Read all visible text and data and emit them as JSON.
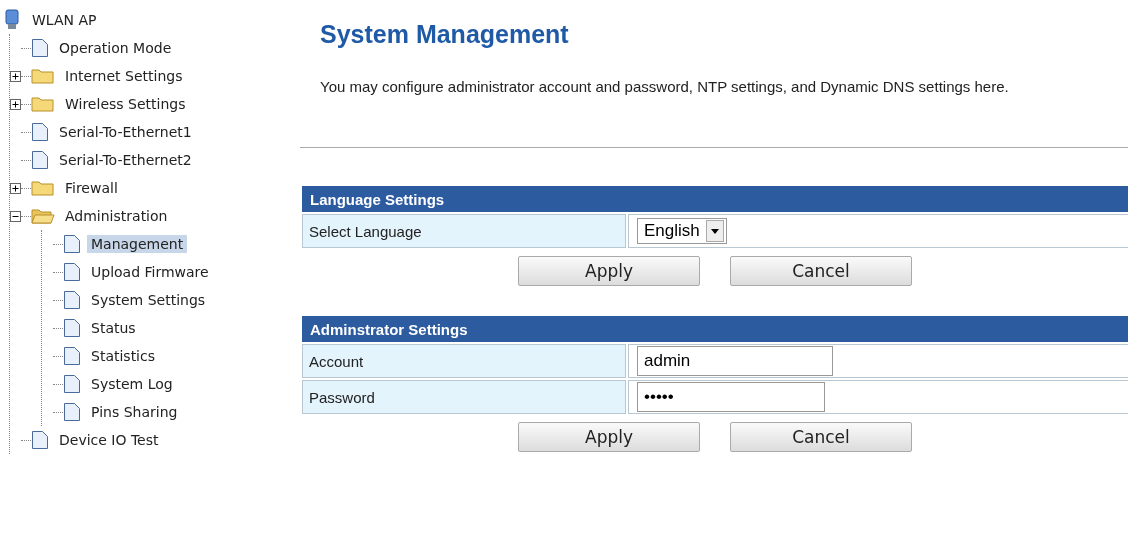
{
  "sidebar": {
    "tree": [
      {
        "label": "WLAN AP",
        "kind": "root",
        "selected": false,
        "children": [
          {
            "label": "Operation Mode",
            "kind": "page",
            "selected": false
          },
          {
            "label": "Internet Settings",
            "kind": "folder",
            "expanded": false,
            "selected": false
          },
          {
            "label": "Wireless Settings",
            "kind": "folder",
            "expanded": false,
            "selected": false
          },
          {
            "label": "Serial-To-Ethernet1",
            "kind": "page",
            "selected": false
          },
          {
            "label": "Serial-To-Ethernet2",
            "kind": "page",
            "selected": false
          },
          {
            "label": "Firewall",
            "kind": "folder",
            "expanded": false,
            "selected": false
          },
          {
            "label": "Administration",
            "kind": "folder",
            "expanded": true,
            "selected": false,
            "children": [
              {
                "label": "Management",
                "kind": "page",
                "selected": true
              },
              {
                "label": "Upload Firmware",
                "kind": "page",
                "selected": false
              },
              {
                "label": "System Settings",
                "kind": "page",
                "selected": false
              },
              {
                "label": "Status",
                "kind": "page",
                "selected": false
              },
              {
                "label": "Statistics",
                "kind": "page",
                "selected": false
              },
              {
                "label": "System Log",
                "kind": "page",
                "selected": false
              },
              {
                "label": "Pins Sharing",
                "kind": "page",
                "selected": false
              }
            ]
          },
          {
            "label": "Device IO Test",
            "kind": "page",
            "selected": false
          }
        ]
      }
    ]
  },
  "page": {
    "title": "System Management",
    "description": "You may configure administrator account and password, NTP settings, and Dynamic DNS settings here."
  },
  "sections": [
    {
      "title": "Language Settings",
      "rows": [
        {
          "label": "Select Language",
          "kind": "select",
          "value": "English"
        }
      ],
      "buttons": [
        "Apply",
        "Cancel"
      ]
    },
    {
      "title": "Adminstrator Settings",
      "rows": [
        {
          "label": "Account",
          "kind": "text",
          "value": "admin"
        },
        {
          "label": "Password",
          "kind": "password",
          "value": "•••••"
        }
      ],
      "buttons": [
        "Apply",
        "Cancel"
      ]
    }
  ]
}
